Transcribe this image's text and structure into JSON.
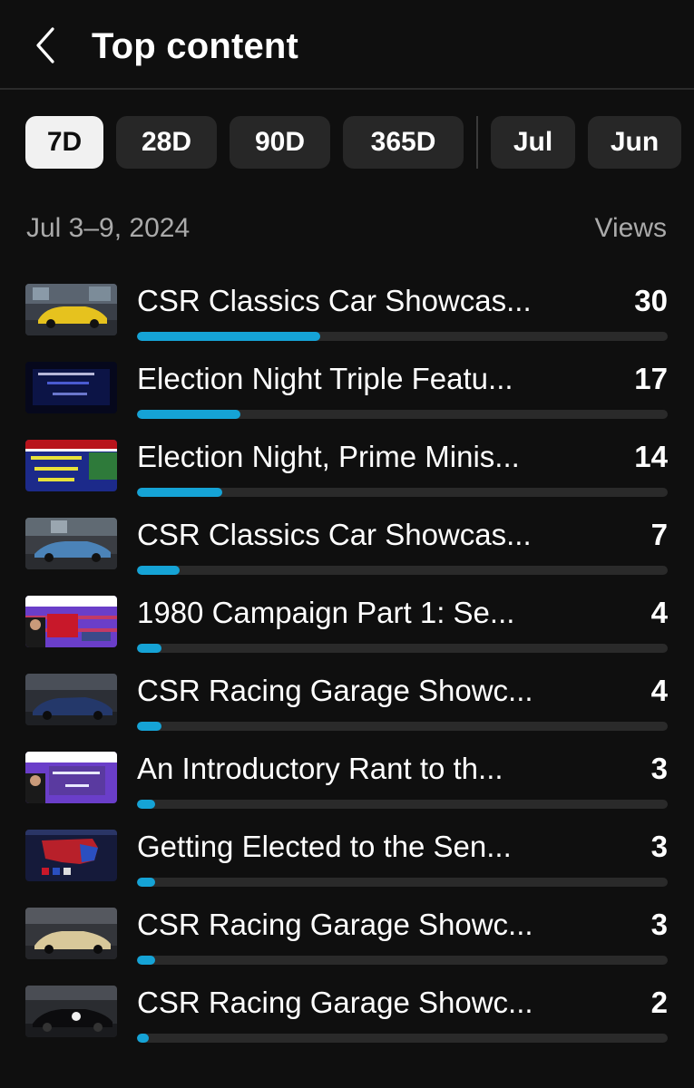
{
  "header": {
    "title": "Top content",
    "back_icon": "chevron-left-icon"
  },
  "filters": [
    {
      "label": "7D",
      "selected": true
    },
    {
      "label": "28D",
      "selected": false
    },
    {
      "label": "90D",
      "selected": false
    },
    {
      "label": "365D",
      "selected": false
    },
    {
      "label": "Jul",
      "selected": false
    },
    {
      "label": "Jun",
      "selected": false
    }
  ],
  "date_range": "Jul 3–9, 2024",
  "views_header": "Views",
  "colors": {
    "background": "#0f0f0f",
    "chip": "#272727",
    "chip_selected": "#f1f1f1",
    "bar_track": "#2a2a2a",
    "bar_fill": "#15a3d6"
  },
  "items": [
    {
      "title": "CSR Classics Car Showcas...",
      "views": "30",
      "thumbnail": "yellow-classic-car-thumbnail"
    },
    {
      "title": "Election Night Triple Featu...",
      "views": "17",
      "thumbnail": "prime-minister-infinity-title-thumbnail"
    },
    {
      "title": "Election Night, Prime Minis...",
      "views": "14",
      "thumbnail": "election-night-base-scenarios-thumbnail"
    },
    {
      "title": "CSR Classics Car Showcas...",
      "views": "7",
      "thumbnail": "blue-classic-car-thumbnail"
    },
    {
      "title": "1980 Campaign Part 1: Se...",
      "views": "4",
      "thumbnail": "1980-campaign-reagan-thumbnail"
    },
    {
      "title": "CSR Racing Garage Showc...",
      "views": "4",
      "thumbnail": "blue-sports-car-thumbnail"
    },
    {
      "title": "An Introductory Rant to th...",
      "views": "3",
      "thumbnail": "introductory-rant-thumbnail"
    },
    {
      "title": "Getting Elected to the Sen...",
      "views": "3",
      "thumbnail": "electoral-map-thumbnail"
    },
    {
      "title": "CSR Racing Garage Showc...",
      "views": "3",
      "thumbnail": "gold-supercar-thumbnail"
    },
    {
      "title": "CSR Racing Garage Showc...",
      "views": "2",
      "thumbnail": "black-supercar-thumbnail"
    }
  ]
}
